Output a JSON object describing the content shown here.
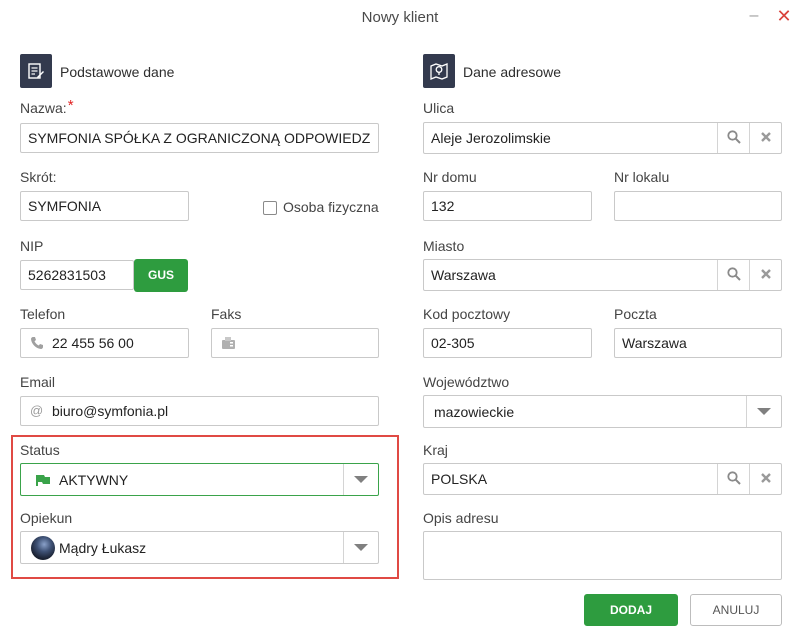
{
  "window": {
    "title": "Nowy klient",
    "minimize_glyph": "–",
    "close_glyph": "✕"
  },
  "colors": {
    "accent_green": "#2e9c3f",
    "section_icon_bg": "#333a4e",
    "highlight_red": "#e04a44",
    "required_red": "#e02020"
  },
  "basic": {
    "section_title": "Podstawowe dane",
    "section_icon": "document-edit-icon",
    "name": {
      "label": "Nazwa:",
      "required_mark": "*",
      "value": "SYMFONIA SPÓŁKA Z OGRANICZONĄ ODPOWIEDZIALNOŚCIĄ"
    },
    "short": {
      "label": "Skrót:",
      "value": "SYMFONIA"
    },
    "natural_person": {
      "label": "Osoba fizyczna",
      "checked": false
    },
    "nip": {
      "label": "NIP",
      "value": "5262831503",
      "gus_button": "GUS"
    },
    "phone": {
      "label": "Telefon",
      "value": "22 455 56 00",
      "icon": "phone-icon"
    },
    "fax": {
      "label": "Faks",
      "value": "",
      "icon": "fax-icon"
    },
    "email": {
      "label": "Email",
      "value": "biuro@symfonia.pl",
      "icon": "at-icon",
      "glyph": "@"
    },
    "status": {
      "label": "Status",
      "value": "AKTYWNY",
      "icon": "flag-icon"
    },
    "guardian": {
      "label": "Opiekun",
      "value": "Mądry Łukasz",
      "icon": "avatar"
    }
  },
  "address": {
    "section_title": "Dane adresowe",
    "section_icon": "map-pin-icon",
    "street": {
      "label": "Ulica",
      "value": "Aleje Jerozolimskie"
    },
    "house_no": {
      "label": "Nr domu",
      "value": "132"
    },
    "apartment_no": {
      "label": "Nr lokalu",
      "value": ""
    },
    "city": {
      "label": "Miasto",
      "value": "Warszawa"
    },
    "postal_code": {
      "label": "Kod pocztowy",
      "value": "02-305"
    },
    "post_office": {
      "label": "Poczta",
      "value": "Warszawa"
    },
    "voivodeship": {
      "label": "Województwo",
      "value": "mazowieckie"
    },
    "country": {
      "label": "Kraj",
      "value": "POLSKA"
    },
    "description": {
      "label": "Opis adresu",
      "value": ""
    }
  },
  "actions": {
    "add": "DODAJ",
    "cancel": "ANULUJ"
  }
}
